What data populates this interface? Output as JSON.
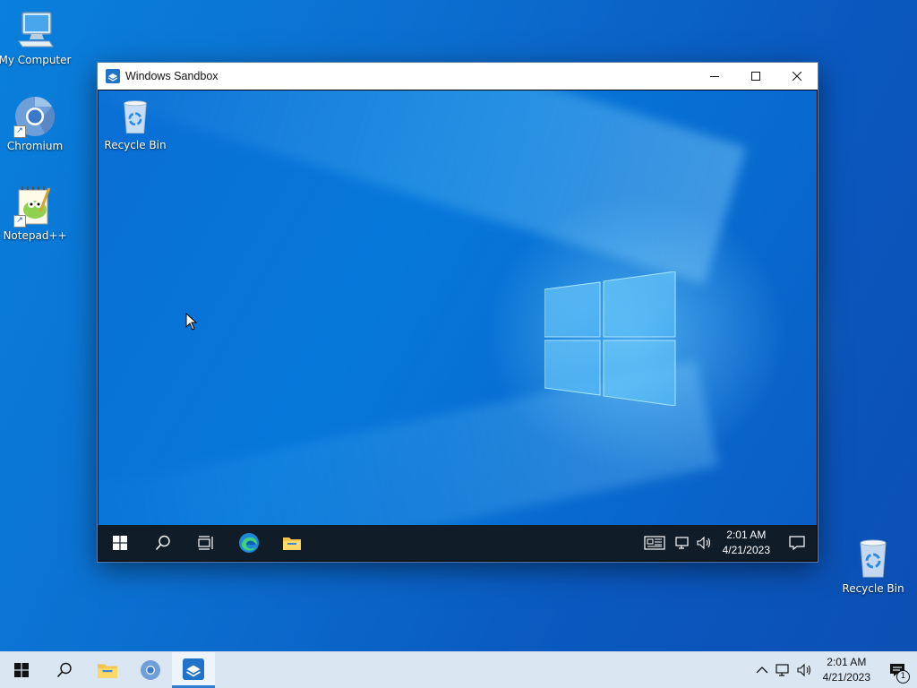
{
  "desktop": {
    "icons": [
      {
        "label": "My Computer",
        "icon": "computer-icon"
      },
      {
        "label": "Chromium",
        "icon": "chromium-icon"
      },
      {
        "label": "Notepad++",
        "icon": "notepadpp-icon"
      },
      {
        "label": "Recycle Bin",
        "icon": "recycle-bin-icon"
      }
    ]
  },
  "window": {
    "title": "Windows Sandbox",
    "controls": [
      "minimize-icon",
      "maximize-icon",
      "close-icon"
    ],
    "sandbox": {
      "desktop_icon_label": "Recycle Bin",
      "taskbar": {
        "buttons": [
          "windows-start-icon",
          "search-icon",
          "task-view-icon",
          "edge-icon",
          "file-explorer-icon"
        ],
        "tray": [
          "news-icon",
          "network-icon",
          "volume-icon"
        ],
        "time": "2:01 AM",
        "date": "4/21/2023",
        "notification": "action-center-icon"
      }
    }
  },
  "taskbar": {
    "buttons": [
      "windows-start-icon",
      "search-icon",
      "file-explorer-icon",
      "chromium-icon",
      "windows-sandbox-icon"
    ],
    "active": "windows-sandbox-icon",
    "tray": [
      "chevron-up-icon",
      "network-icon",
      "volume-icon"
    ],
    "time": "2:01 AM",
    "date": "4/21/2023",
    "notification_count": "1"
  },
  "colors": {
    "desktop": "#0b6fd0",
    "sandbox_taskbar": "#101c28",
    "host_taskbar": "#dae6f2",
    "accent": "#2f7fd1"
  }
}
